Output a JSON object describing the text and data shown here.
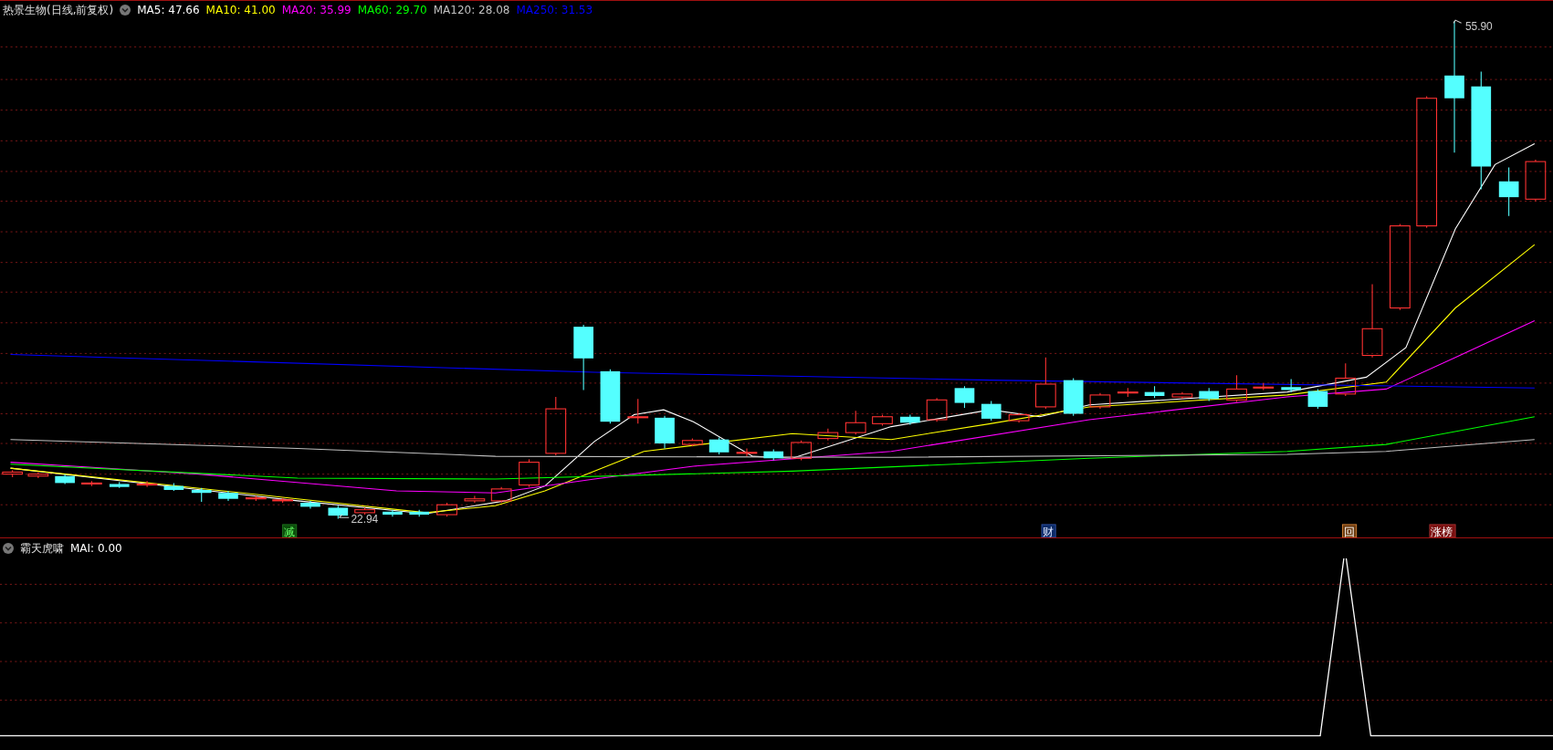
{
  "main_panel": {
    "title": "热景生物(日线,前复权)",
    "indicators": [
      {
        "label": "MA5: 47.66",
        "color": "#ffffff"
      },
      {
        "label": "MA10: 41.00",
        "color": "#ffff00"
      },
      {
        "label": "MA20: 35.99",
        "color": "#ff00ff"
      },
      {
        "label": "MA60: 29.70",
        "color": "#00ff00"
      },
      {
        "label": "MA120: 28.08",
        "color": "#c0c0c0"
      },
      {
        "label": "MA250: 31.53",
        "color": "#0000ff"
      }
    ],
    "high_label": "55.90",
    "low_label": "22.94",
    "event_markers": [
      {
        "label": "减",
        "kind": "reduce"
      },
      {
        "label": "财",
        "kind": "finance"
      },
      {
        "label": "回",
        "kind": "buyback"
      },
      {
        "label": "涨榜",
        "kind": "list"
      }
    ]
  },
  "sub_panel": {
    "title": "霸天虎啸",
    "indicators": [
      {
        "label": "MAI: 0.00",
        "color": "#ffffff"
      }
    ]
  }
}
